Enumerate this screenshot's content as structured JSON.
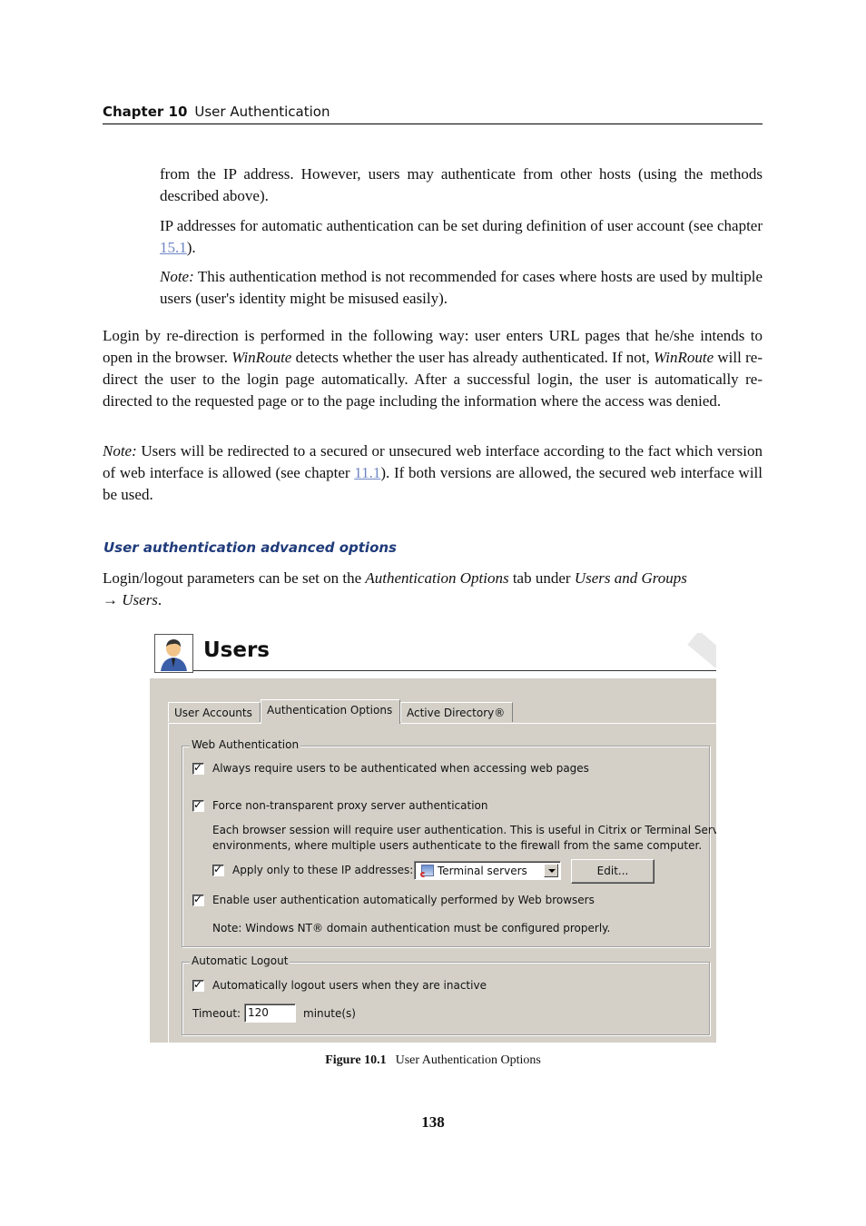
{
  "header": {
    "chapter_label": "Chapter 10",
    "chapter_title": "User Authentication"
  },
  "paragraphs": {
    "p1": "from the IP address.  However, users may authenticate from other hosts (using the methods described above).",
    "p2_before": "IP addresses for automatic authentication can be set during definition of user account (see chapter ",
    "p2_link": "15.1",
    "p2_after": ").",
    "p3_note": "Note:",
    "p3_text": " This authentication method is not recommended for cases where hosts are used by multiple users (user's identity might be misused easily).",
    "p4_a": "Login by re-direction is performed in the following way: user enters URL pages that he/she intends to open in the browser. ",
    "p4_em1": "WinRoute",
    "p4_b": " detects whether the user has already authenticated. If not, ",
    "p4_em2": "WinRoute",
    "p4_c": " will re-direct the user to the login page automatically.  After a successful login, the user is automatically re-directed to the requested page or to the page including the information where the access was denied.",
    "p5_note": "Note:",
    "p5_a": " Users will be redirected to a secured or unsecured web interface according to the fact which version of web interface is allowed (see chapter ",
    "p5_link": "11.1",
    "p5_b": "). If both versions are allowed, the secured web interface will be used.",
    "subheading": "User authentication advanced options",
    "p6_a": "Login/logout parameters can be set on the ",
    "p6_em1": "Authentication Options",
    "p6_b": " tab under ",
    "p6_em2": "Users and Groups",
    "p6_arrow": "→ ",
    "p6_em3": "Users",
    "p6_end": "."
  },
  "figure": {
    "title": "Users",
    "icon": "user-icon",
    "tabs": [
      {
        "label": "User Accounts",
        "active": false
      },
      {
        "label": "Authentication Options",
        "active": true
      },
      {
        "label": "Active Directory®",
        "active": false
      }
    ],
    "web_auth": {
      "legend": "Web Authentication",
      "always_require": {
        "label": "Always require users to be authenticated when accessing web pages",
        "checked": true
      },
      "force_proxy": {
        "label": "Force non-transparent proxy server authentication",
        "checked": true
      },
      "force_proxy_desc1": "Each browser session will require user authentication. This is useful in Citrix or Terminal Service",
      "force_proxy_desc2": "environments, where multiple users authenticate to the firewall from the same computer.",
      "apply_only": {
        "label": "Apply only to these IP addresses:",
        "checked": true
      },
      "ip_group_selected": "Terminal servers",
      "edit_button": "Edit...",
      "enable_browser_auth": {
        "label": "Enable user authentication automatically performed by Web browsers",
        "checked": true
      },
      "nt_note": "Note: Windows NT® domain authentication must be configured properly."
    },
    "auto_logout": {
      "legend": "Automatic Logout",
      "auto_logout_inactive": {
        "label": "Automatically logout users when they are inactive",
        "checked": true
      },
      "timeout_label": "Timeout:",
      "timeout_value": "120",
      "timeout_unit": "minute(s)"
    },
    "caption_label": "Figure 10.1",
    "caption_text": "User Authentication Options"
  },
  "page_number": "138"
}
